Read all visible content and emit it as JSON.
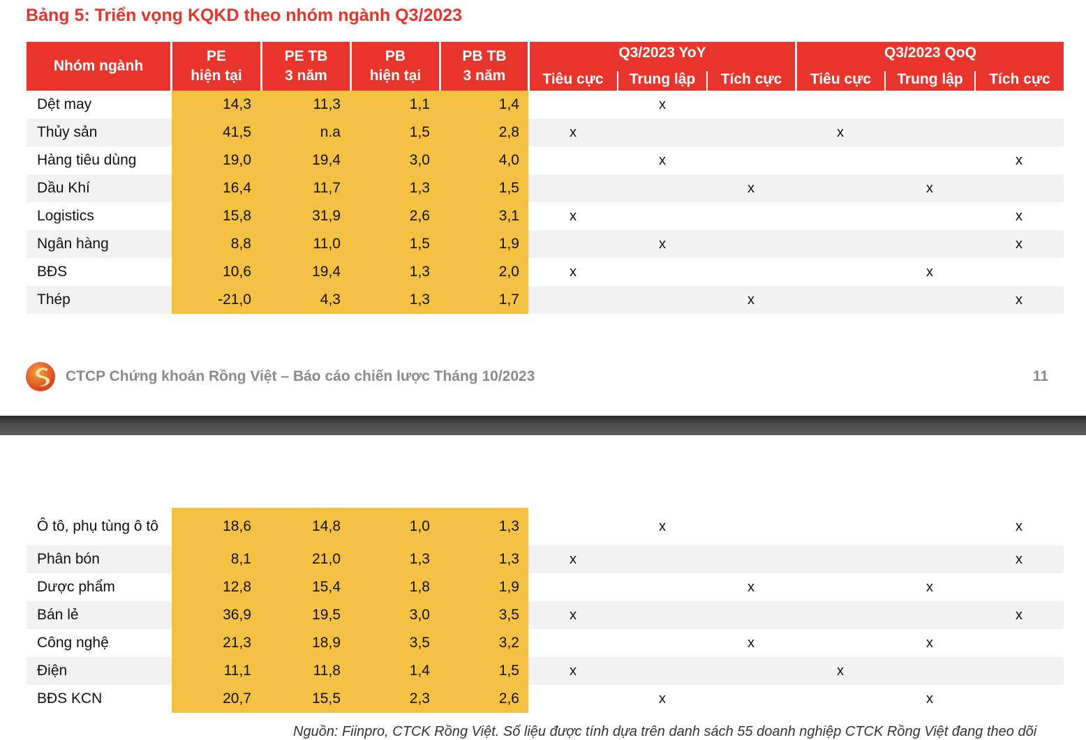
{
  "title": "Bảng 5: Triển vọng KQKD theo nhóm ngành Q3/2023",
  "header": {
    "sector": "Nhóm ngành",
    "pe": [
      "PE",
      "hiện tại"
    ],
    "pe_avg": [
      "PE TB",
      "3 năm"
    ],
    "pb": [
      "PB",
      "hiện tại"
    ],
    "pb_avg": [
      "PB TB",
      "3 năm"
    ],
    "yoy": "Q3/2023 YoY",
    "qoq": "Q3/2023 QoQ",
    "neg": "Tiêu cực",
    "neu": "Trung lập",
    "pos": "Tích cực"
  },
  "rows_top": [
    {
      "name": "Dệt may",
      "pe": "14,3",
      "pe_avg": "11,3",
      "pb": "1,1",
      "pb_avg": "1,4",
      "yoy": "neu",
      "qoq": ""
    },
    {
      "name": "Thủy sản",
      "pe": "41,5",
      "pe_avg": "n.a",
      "pb": "1,5",
      "pb_avg": "2,8",
      "yoy": "neg",
      "qoq": "neg"
    },
    {
      "name": "Hàng tiêu dùng",
      "pe": "19,0",
      "pe_avg": "19,4",
      "pb": "3,0",
      "pb_avg": "4,0",
      "yoy": "neu",
      "qoq": "pos"
    },
    {
      "name": "Dầu Khí",
      "pe": "16,4",
      "pe_avg": "11,7",
      "pb": "1,3",
      "pb_avg": "1,5",
      "yoy": "pos",
      "qoq": "neu"
    },
    {
      "name": "Logistics",
      "pe": "15,8",
      "pe_avg": "31,9",
      "pb": "2,6",
      "pb_avg": "3,1",
      "yoy": "neg",
      "qoq": "pos"
    },
    {
      "name": "Ngân hàng",
      "pe": "8,8",
      "pe_avg": "11,0",
      "pb": "1,5",
      "pb_avg": "1,9",
      "yoy": "neu",
      "qoq": "pos"
    },
    {
      "name": "BĐS",
      "pe": "10,6",
      "pe_avg": "19,4",
      "pb": "1,3",
      "pb_avg": "2,0",
      "yoy": "neg",
      "qoq": "neu"
    },
    {
      "name": "Thép",
      "pe": "-21,0",
      "pe_avg": "4,3",
      "pb": "1,3",
      "pb_avg": "1,7",
      "yoy": "pos",
      "qoq": "pos"
    }
  ],
  "rows_bottom": [
    {
      "name": "Ô tô, phụ tùng ô tô",
      "pe": "18,6",
      "pe_avg": "14,8",
      "pb": "1,0",
      "pb_avg": "1,3",
      "yoy": "neu",
      "qoq": "pos"
    },
    {
      "name": "Phân bón",
      "pe": "8,1",
      "pe_avg": "21,0",
      "pb": "1,3",
      "pb_avg": "1,3",
      "yoy": "neg",
      "qoq": "pos"
    },
    {
      "name": "Dược phẩm",
      "pe": "12,8",
      "pe_avg": "15,4",
      "pb": "1,8",
      "pb_avg": "1,9",
      "yoy": "pos",
      "qoq": "neu"
    },
    {
      "name": "Bán lẻ",
      "pe": "36,9",
      "pe_avg": "19,5",
      "pb": "3,0",
      "pb_avg": "3,5",
      "yoy": "neg",
      "qoq": "pos"
    },
    {
      "name": "Công nghệ",
      "pe": "21,3",
      "pe_avg": "18,9",
      "pb": "3,5",
      "pb_avg": "3,2",
      "yoy": "pos",
      "qoq": "neu"
    },
    {
      "name": "Điện",
      "pe": "11,1",
      "pe_avg": "11,8",
      "pb": "1,4",
      "pb_avg": "1,5",
      "yoy": "neg",
      "qoq": "neg"
    },
    {
      "name": "BĐS KCN",
      "pe": "20,7",
      "pe_avg": "15,5",
      "pb": "2,3",
      "pb_avg": "2,6",
      "yoy": "neu",
      "qoq": "neu"
    }
  ],
  "mark": "x",
  "footer": {
    "company": "CTCP Chứng khoán Rồng Việt – Báo cáo chiến lược Tháng 10/2023",
    "page": "11",
    "logo_icon": "dragon-logo-icon"
  },
  "source_note": "Nguồn: Fiinpro, CTCK Rồng Việt. Số liệu được tính dựa trên danh sách 55 doanh nghiệp CTCK Rồng Việt đang theo dõi",
  "colors": {
    "accent_red": "#e8342a",
    "highlight_yellow": "#f4c142",
    "alt_row": "#f2f2f2"
  }
}
